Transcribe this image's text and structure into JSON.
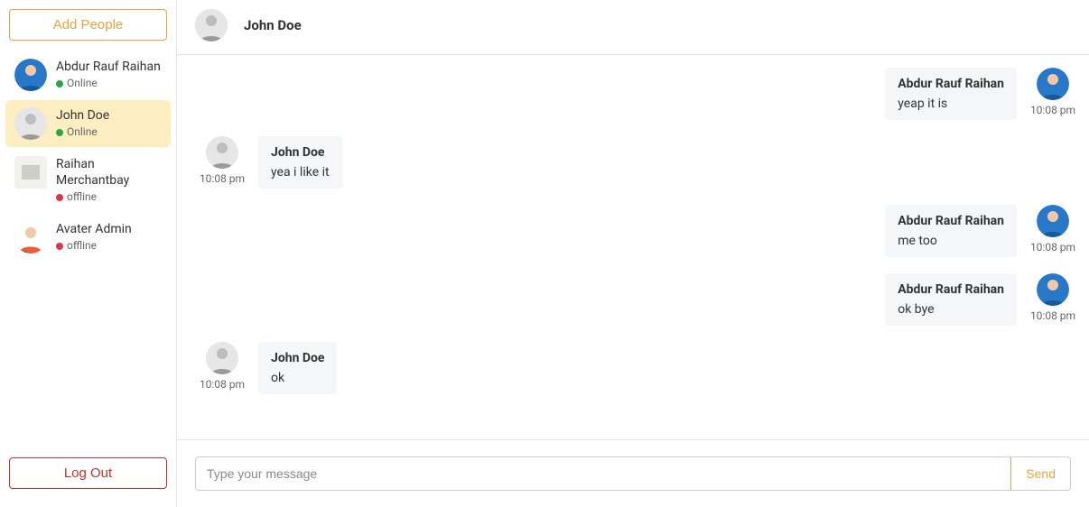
{
  "sidebar": {
    "add_people_label": "Add People",
    "logout_label": "Log Out",
    "contacts": [
      {
        "name": "Abdur Rauf Raihan",
        "status_label": "Online",
        "status": "online",
        "avatar_color": "#2878c9",
        "avatar_shape": "round"
      },
      {
        "name": "John Doe",
        "status_label": "Online",
        "status": "online",
        "avatar_color": "#bfbfbf",
        "avatar_shape": "round",
        "active": true
      },
      {
        "name": "Raihan Merchantbay",
        "status_label": "offline",
        "status": "offline",
        "avatar_color": "#e9e9e0",
        "avatar_shape": "square"
      },
      {
        "name": "Avater Admin",
        "status_label": "offline",
        "status": "offline",
        "avatar_color": "#f05a3a",
        "avatar_shape": "round"
      }
    ]
  },
  "chat": {
    "header_name": "John Doe",
    "header_avatar_color": "#bfbfbf",
    "messages": [
      {
        "side": "right",
        "sender": "Abdur Rauf Raihan",
        "text": "yeap it is",
        "time": "10:08 pm",
        "avatar_color": "#2878c9"
      },
      {
        "side": "left",
        "sender": "John Doe",
        "text": "yea i like it",
        "time": "10:08 pm",
        "avatar_color": "#bfbfbf"
      },
      {
        "side": "right",
        "sender": "Abdur Rauf Raihan",
        "text": "me too",
        "time": "10:08 pm",
        "avatar_color": "#2878c9"
      },
      {
        "side": "right",
        "sender": "Abdur Rauf Raihan",
        "text": "ok bye",
        "time": "10:08 pm",
        "avatar_color": "#2878c9"
      },
      {
        "side": "left",
        "sender": "John Doe",
        "text": "ok",
        "time": "10:08 pm",
        "avatar_color": "#bfbfbf"
      }
    ]
  },
  "composer": {
    "placeholder": "Type your message",
    "send_label": "Send"
  },
  "colors": {
    "accent": "#e8a33d",
    "danger": "#c9302c",
    "online": "#28a745",
    "offline": "#dc3545"
  }
}
